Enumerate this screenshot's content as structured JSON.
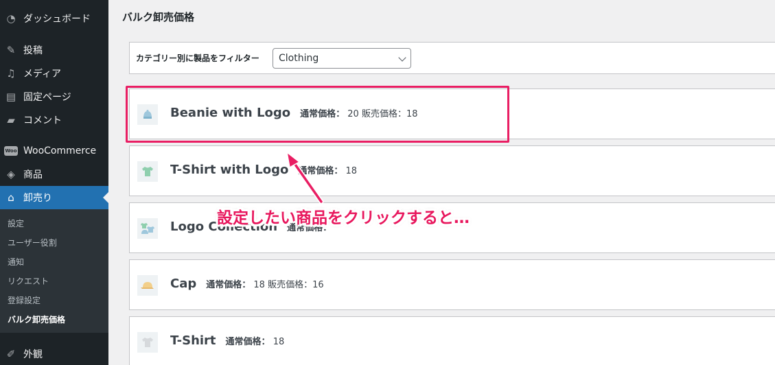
{
  "sidebar": {
    "items": [
      {
        "label": "ダッシュボード",
        "icon": "dashboard-icon"
      },
      {
        "label": "投稿",
        "icon": "pin-icon"
      },
      {
        "label": "メディア",
        "icon": "media-icon"
      },
      {
        "label": "固定ページ",
        "icon": "page-icon"
      },
      {
        "label": "コメント",
        "icon": "comment-icon"
      },
      {
        "label": "WooCommerce",
        "icon": "woocommerce-icon",
        "icon_text": "Woo"
      },
      {
        "label": "商品",
        "icon": "box-icon"
      },
      {
        "label": "卸売り",
        "icon": "store-icon"
      },
      {
        "label": "外観",
        "icon": "brush-icon"
      }
    ],
    "submenu": [
      "設定",
      "ユーザー役割",
      "通知",
      "リクエスト",
      "登録設定",
      "バルク卸売価格"
    ]
  },
  "main": {
    "title": "バルク卸売価格",
    "filter": {
      "label": "カテゴリー別に製品をフィルター",
      "selected": "Clothing"
    },
    "products": [
      {
        "name": "Beanie with Logo",
        "regular_label": "通常価格：",
        "regular": "20",
        "sale_label": "販売価格：",
        "sale": "18"
      },
      {
        "name": "T-Shirt with Logo",
        "regular_label": "通常価格：",
        "regular": "18"
      },
      {
        "name": "Logo Collection",
        "regular_label": "通常価格："
      },
      {
        "name": "Cap",
        "regular_label": "通常価格：",
        "regular": "18",
        "sale_label": "販売価格：",
        "sale": "16"
      },
      {
        "name": "T-Shirt",
        "regular_label": "通常価格：",
        "regular": "18"
      }
    ]
  },
  "annotation": "設定したい商品をクリックすると…",
  "colors": {
    "sidebar": "#1d2327",
    "active": "#2271b1",
    "highlight": "#e91e63"
  }
}
